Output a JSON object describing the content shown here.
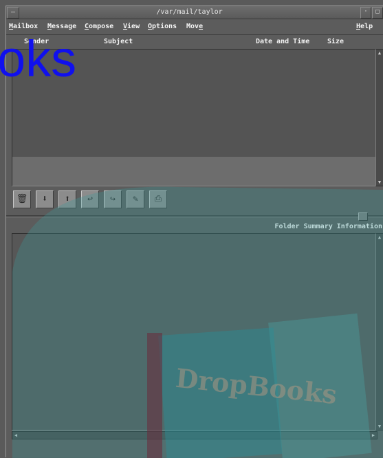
{
  "window": {
    "title": "/var/mail/taylor",
    "sysmenu_glyph": "—",
    "minimize_glyph": "·",
    "maximize_glyph": "□"
  },
  "menubar": {
    "items": [
      {
        "key": "M",
        "rest": "ailbox"
      },
      {
        "key": "M",
        "rest": "essage"
      },
      {
        "key": "C",
        "rest": "ompose"
      },
      {
        "key": "V",
        "rest": "iew"
      },
      {
        "key": "O",
        "rest": "ptions"
      },
      {
        "pre": "Mov",
        "key": "e"
      }
    ],
    "help": {
      "key": "H",
      "rest": "elp"
    }
  },
  "columns": {
    "sender": "Sender",
    "subject": "Subject",
    "date": "Date and Time",
    "size": "Size"
  },
  "toolbar": {
    "buttons": [
      {
        "icon": "trash-icon",
        "glyph": "🗑"
      },
      {
        "icon": "arrow-down-icon",
        "glyph": "⬇"
      },
      {
        "icon": "arrow-up-icon",
        "glyph": "⬆"
      },
      {
        "icon": "reply-icon",
        "glyph": "↩"
      },
      {
        "icon": "forward-icon",
        "glyph": "↪"
      },
      {
        "icon": "compose-icon",
        "glyph": "✎"
      },
      {
        "icon": "print-icon",
        "glyph": "⎙"
      }
    ]
  },
  "viewer": {
    "summary_label": "Folder Summary Information"
  },
  "watermark": {
    "visible_word": "oks",
    "logo_text": "DropBooks"
  },
  "colors": {
    "background": "#5a5a5a",
    "watermark_blue": "#1010ee",
    "watermark_teal": "#3a9a9a"
  }
}
